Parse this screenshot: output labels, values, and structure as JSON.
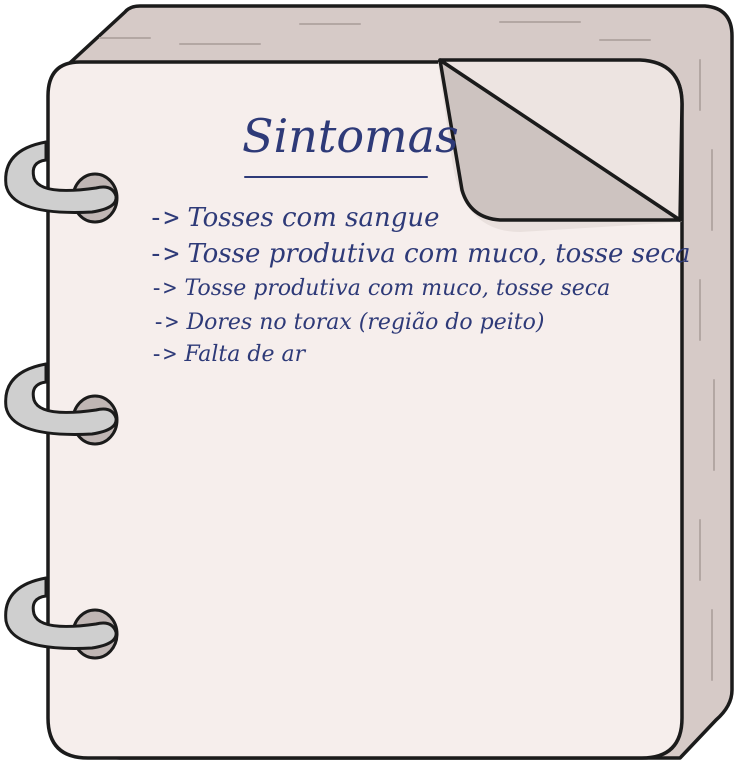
{
  "notebook": {
    "title": "Sintomas",
    "items": [
      {
        "arrow": "->",
        "text": "Tosses com sangue"
      },
      {
        "arrow": "->",
        "text": "Tosse produtiva com muco, tosse seca"
      },
      {
        "arrow": "->",
        "text": "Tosse produtiva com muco, tosse seca"
      },
      {
        "arrow": "->",
        "text": "Dores no torax (região do peito)"
      },
      {
        "arrow": "->",
        "text": "Falta de ar"
      }
    ]
  },
  "colors": {
    "ink": "#2e3a78",
    "page": "#f6eeec",
    "page_edge": "#d6cac7",
    "page_fold": "#cdc3c0",
    "outline": "#1b1b1b",
    "ring": "#c9c9c9"
  },
  "icons": [
    "spiral-ring-icon",
    "page-curl-icon"
  ]
}
